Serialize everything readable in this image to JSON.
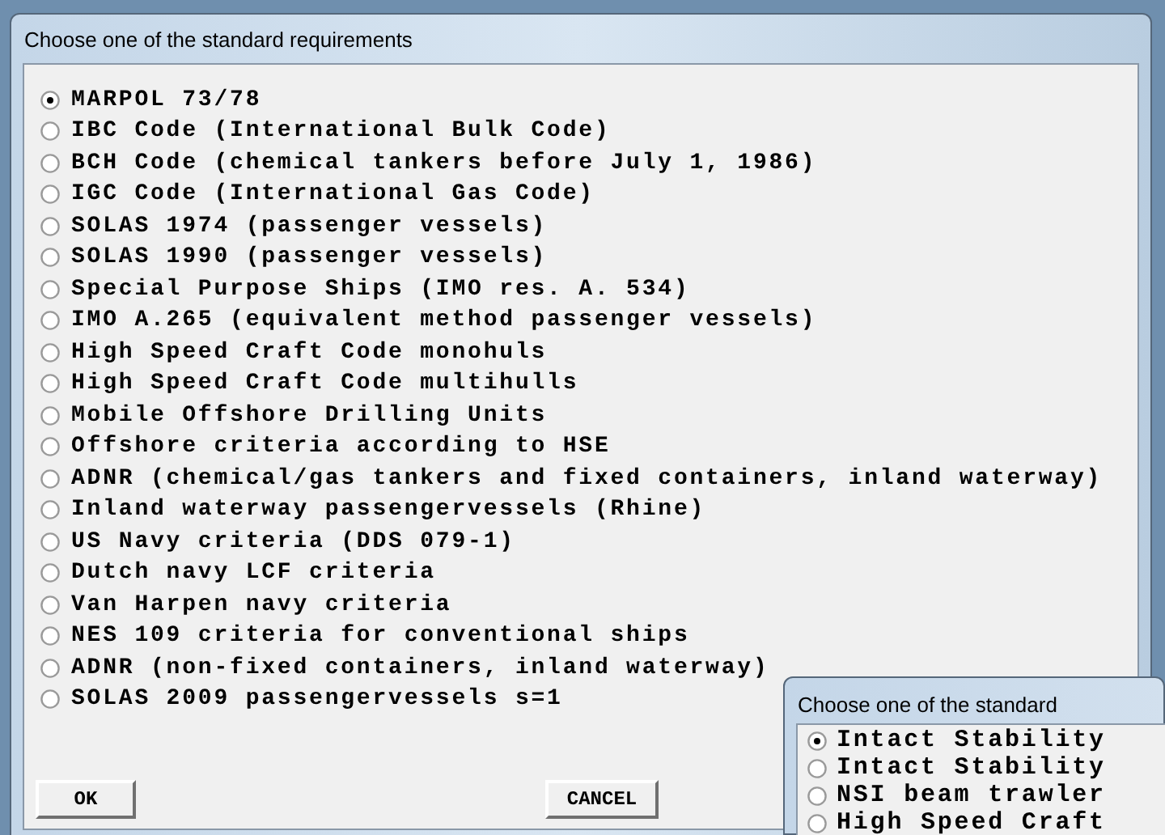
{
  "main_dialog": {
    "title": "Choose one of the standard requirements",
    "options": [
      {
        "label": "MARPOL 73/78",
        "selected": true
      },
      {
        "label": "IBC Code (International Bulk Code)",
        "selected": false
      },
      {
        "label": "BCH Code (chemical tankers before July 1, 1986)",
        "selected": false
      },
      {
        "label": "IGC Code (International Gas Code)",
        "selected": false
      },
      {
        "label": "SOLAS 1974 (passenger vessels)",
        "selected": false
      },
      {
        "label": "SOLAS 1990 (passenger vessels)",
        "selected": false
      },
      {
        "label": "Special Purpose Ships (IMO res. A. 534)",
        "selected": false
      },
      {
        "label": "IMO A.265 (equivalent method passenger vessels)",
        "selected": false
      },
      {
        "label": "High Speed Craft Code monohuls",
        "selected": false
      },
      {
        "label": "High Speed Craft Code multihulls",
        "selected": false
      },
      {
        "label": "Mobile Offshore Drilling Units",
        "selected": false
      },
      {
        "label": "Offshore criteria according to HSE",
        "selected": false
      },
      {
        "label": "ADNR (chemical/gas tankers and fixed containers, inland waterway)",
        "selected": false
      },
      {
        "label": "Inland waterway passengervessels (Rhine)",
        "selected": false
      },
      {
        "label": "US Navy criteria (DDS 079-1)",
        "selected": false
      },
      {
        "label": "Dutch navy LCF criteria",
        "selected": false
      },
      {
        "label": "Van Harpen navy criteria",
        "selected": false
      },
      {
        "label": "NES 109 criteria for conventional ships",
        "selected": false
      },
      {
        "label": "ADNR (non-fixed containers, inland waterway)",
        "selected": false
      },
      {
        "label": "SOLAS 2009 passengervessels s=1",
        "selected": false
      }
    ],
    "buttons": [
      "OK",
      "CANCEL"
    ]
  },
  "second_dialog": {
    "title": "Choose one of the standard",
    "options": [
      {
        "label": "Intact Stability",
        "selected": true
      },
      {
        "label": "Intact Stability",
        "selected": false
      },
      {
        "label": "NSI beam trawler",
        "selected": false
      },
      {
        "label": "High Speed Craft",
        "selected": false
      }
    ]
  }
}
